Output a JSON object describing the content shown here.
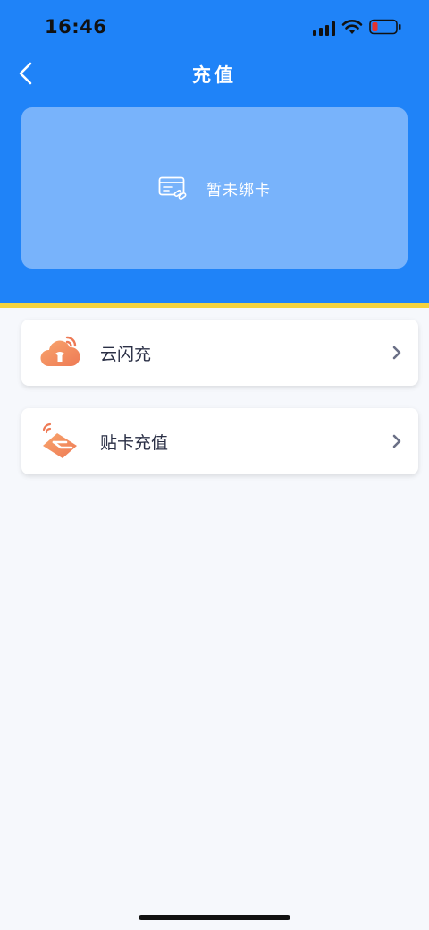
{
  "status_bar": {
    "time": "16:46"
  },
  "nav": {
    "title": "充值"
  },
  "bind_card": {
    "label": "暂未绑卡"
  },
  "menu": {
    "items": [
      {
        "label": "云闪充",
        "icon": "cloud-flash-icon"
      },
      {
        "label": "贴卡充值",
        "icon": "card-tap-icon"
      }
    ]
  },
  "colors": {
    "header_blue": "#1f83f8",
    "panel_blue": "#78b3fb",
    "accent_yellow": "#f5d33d",
    "icon_orange": "#f38a5f"
  }
}
